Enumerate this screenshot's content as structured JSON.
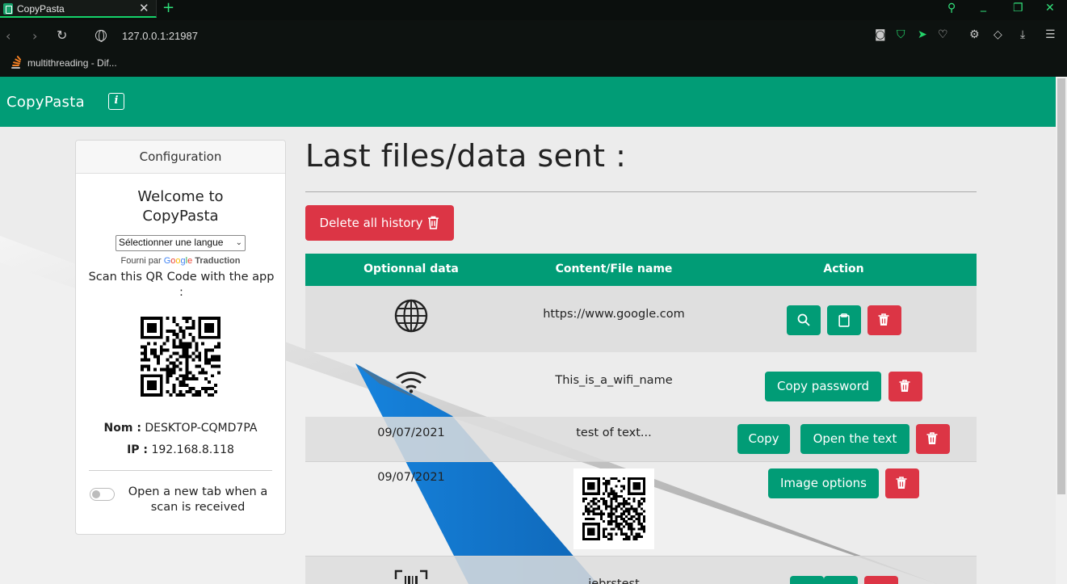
{
  "browser": {
    "tab_title": "CopyPasta",
    "tab_close": "✕",
    "new_tab": "+",
    "url": "127.0.0.1:21987",
    "bookmark_label": "multithreading - Dif..."
  },
  "app": {
    "brand": "CopyPasta",
    "info_icon": "i"
  },
  "config": {
    "header": "Configuration",
    "welcome": "Welcome to CopyPasta",
    "language_select": "Sélectionner une langue",
    "powered_by": "Fourni par",
    "translate_label": "Traduction",
    "scan_text": "Scan this QR Code with the app :",
    "name_label": "Nom :",
    "name_value": "DESKTOP-CQMD7PA",
    "ip_label": "IP :",
    "ip_value": "192.168.8.118",
    "toggle_label": "Open a new tab when a scan is received",
    "toggle_on": false
  },
  "main": {
    "title": "Last files/data sent :",
    "delete_all_label": "Delete all history",
    "columns": [
      "Optionnal data",
      "Content/File name",
      "Action"
    ],
    "rows": [
      {
        "type": "url",
        "optional_icon": "globe-icon",
        "content": "https://www.google.com"
      },
      {
        "type": "wifi",
        "optional_icon": "wifi-icon",
        "content": "This_is_a_wifi_name",
        "action_label": "Copy password"
      },
      {
        "type": "text",
        "optional": "09/07/2021",
        "content": "test of text...",
        "copy_label": "Copy",
        "open_label": "Open the text"
      },
      {
        "type": "image",
        "optional": "09/07/2021",
        "action_label": "Image options"
      },
      {
        "type": "barcode",
        "optional_icon": "barcode-icon",
        "content": "jebrstest"
      }
    ]
  },
  "colors": {
    "primary": "#019c76",
    "danger": "#dc3545",
    "accent_blue": "#1a82d8"
  }
}
